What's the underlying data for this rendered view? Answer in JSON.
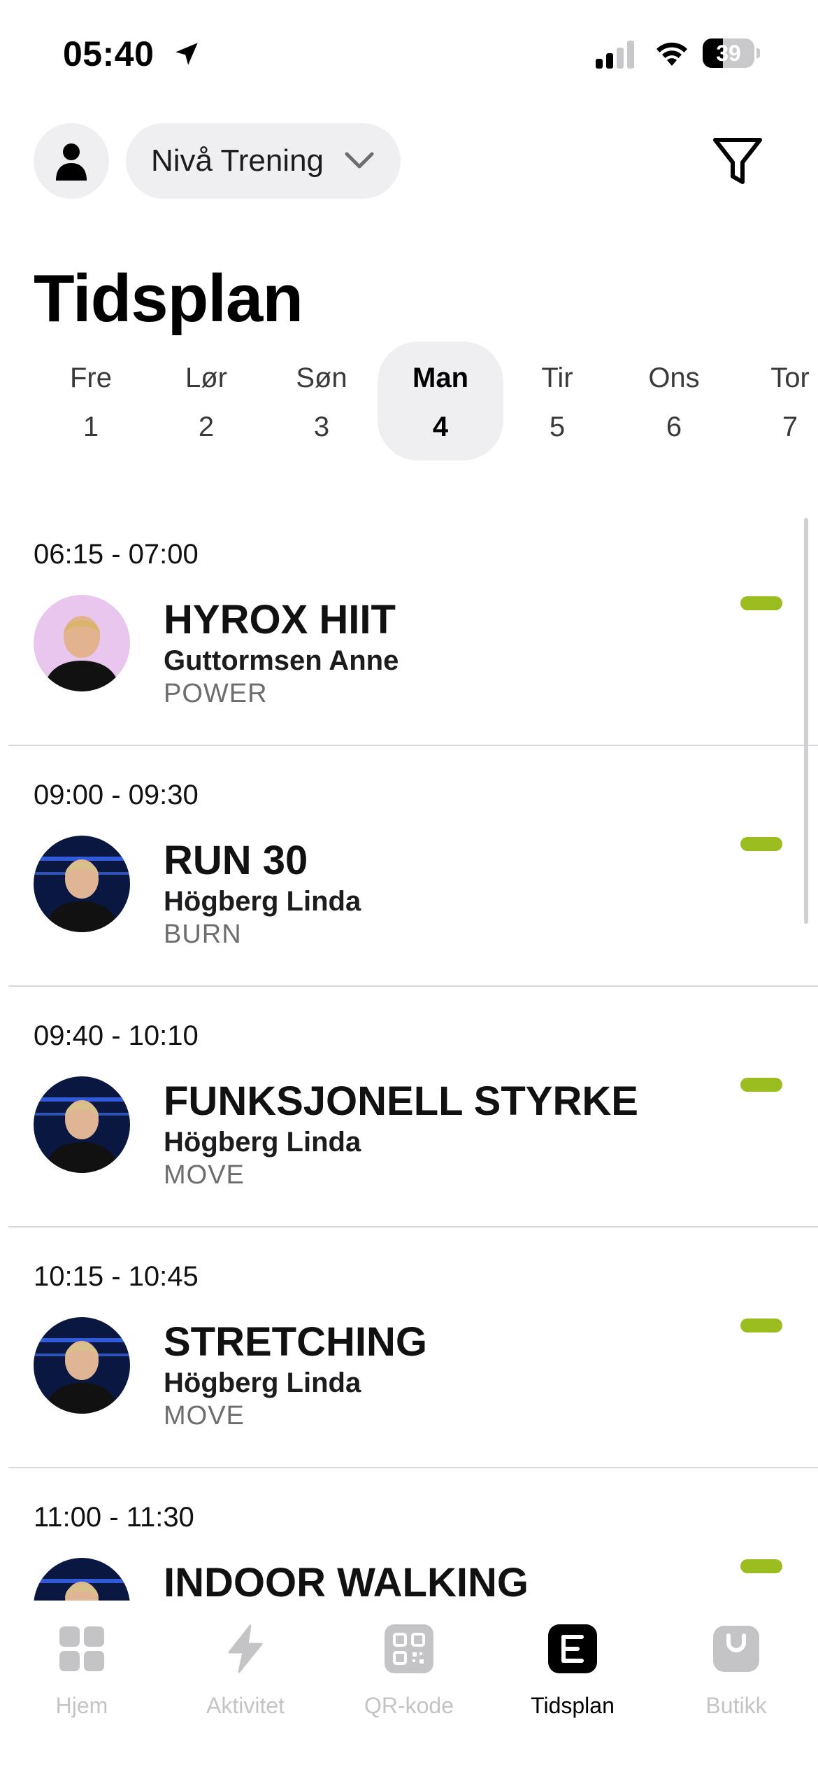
{
  "status_bar": {
    "time": "05:40",
    "battery": "39",
    "battery_level": 0.39,
    "location_icon": "location-arrow-icon",
    "signal_icon": "cellular-signal-icon",
    "wifi_icon": "wifi-icon"
  },
  "header": {
    "profile_icon": "person-icon",
    "gym_selector": "Nivå Trening",
    "filter_icon": "filter-icon",
    "title": "Tidsplan"
  },
  "days": [
    {
      "name": "Fre",
      "num": "1"
    },
    {
      "name": "Lør",
      "num": "2"
    },
    {
      "name": "Søn",
      "num": "3"
    },
    {
      "name": "Man",
      "num": "4",
      "selected": true
    },
    {
      "name": "Tir",
      "num": "5"
    },
    {
      "name": "Ons",
      "num": "6"
    },
    {
      "name": "Tor",
      "num": "7"
    }
  ],
  "classes": [
    {
      "time": "06:15 - 07:00",
      "name": "HYROX HIIT",
      "instructor": "Guttormsen Anne",
      "category": "POWER",
      "status_color": "#9bbd1f"
    },
    {
      "time": "09:00 - 09:30",
      "name": "RUN 30",
      "instructor": "Högberg Linda",
      "category": "BURN",
      "status_color": "#9bbd1f"
    },
    {
      "time": "09:40 - 10:10",
      "name": "FUNKSJONELL STYRKE",
      "instructor": "Högberg Linda",
      "category": "MOVE",
      "status_color": "#9bbd1f"
    },
    {
      "time": "10:15 - 10:45",
      "name": "STRETCHING",
      "instructor": "Högberg Linda",
      "category": "MOVE",
      "status_color": "#9bbd1f"
    },
    {
      "time": "11:00 - 11:30",
      "name": "INDOOR WALKING",
      "instructor": "",
      "category": "",
      "status_color": "#9bbd1f"
    }
  ],
  "tabs": [
    {
      "label": "Hjem",
      "icon": "home-grid-icon"
    },
    {
      "label": "Aktivitet",
      "icon": "lightning-bolt-icon"
    },
    {
      "label": "QR-kode",
      "icon": "qr-code-icon"
    },
    {
      "label": "Tidsplan",
      "icon": "schedule-icon",
      "active": true
    },
    {
      "label": "Butikk",
      "icon": "shopping-bag-icon"
    }
  ],
  "colors": {
    "accent_green": "#9bbd1f",
    "chip_background": "#efeff2",
    "inactive_tab": "#c4c4c6"
  }
}
